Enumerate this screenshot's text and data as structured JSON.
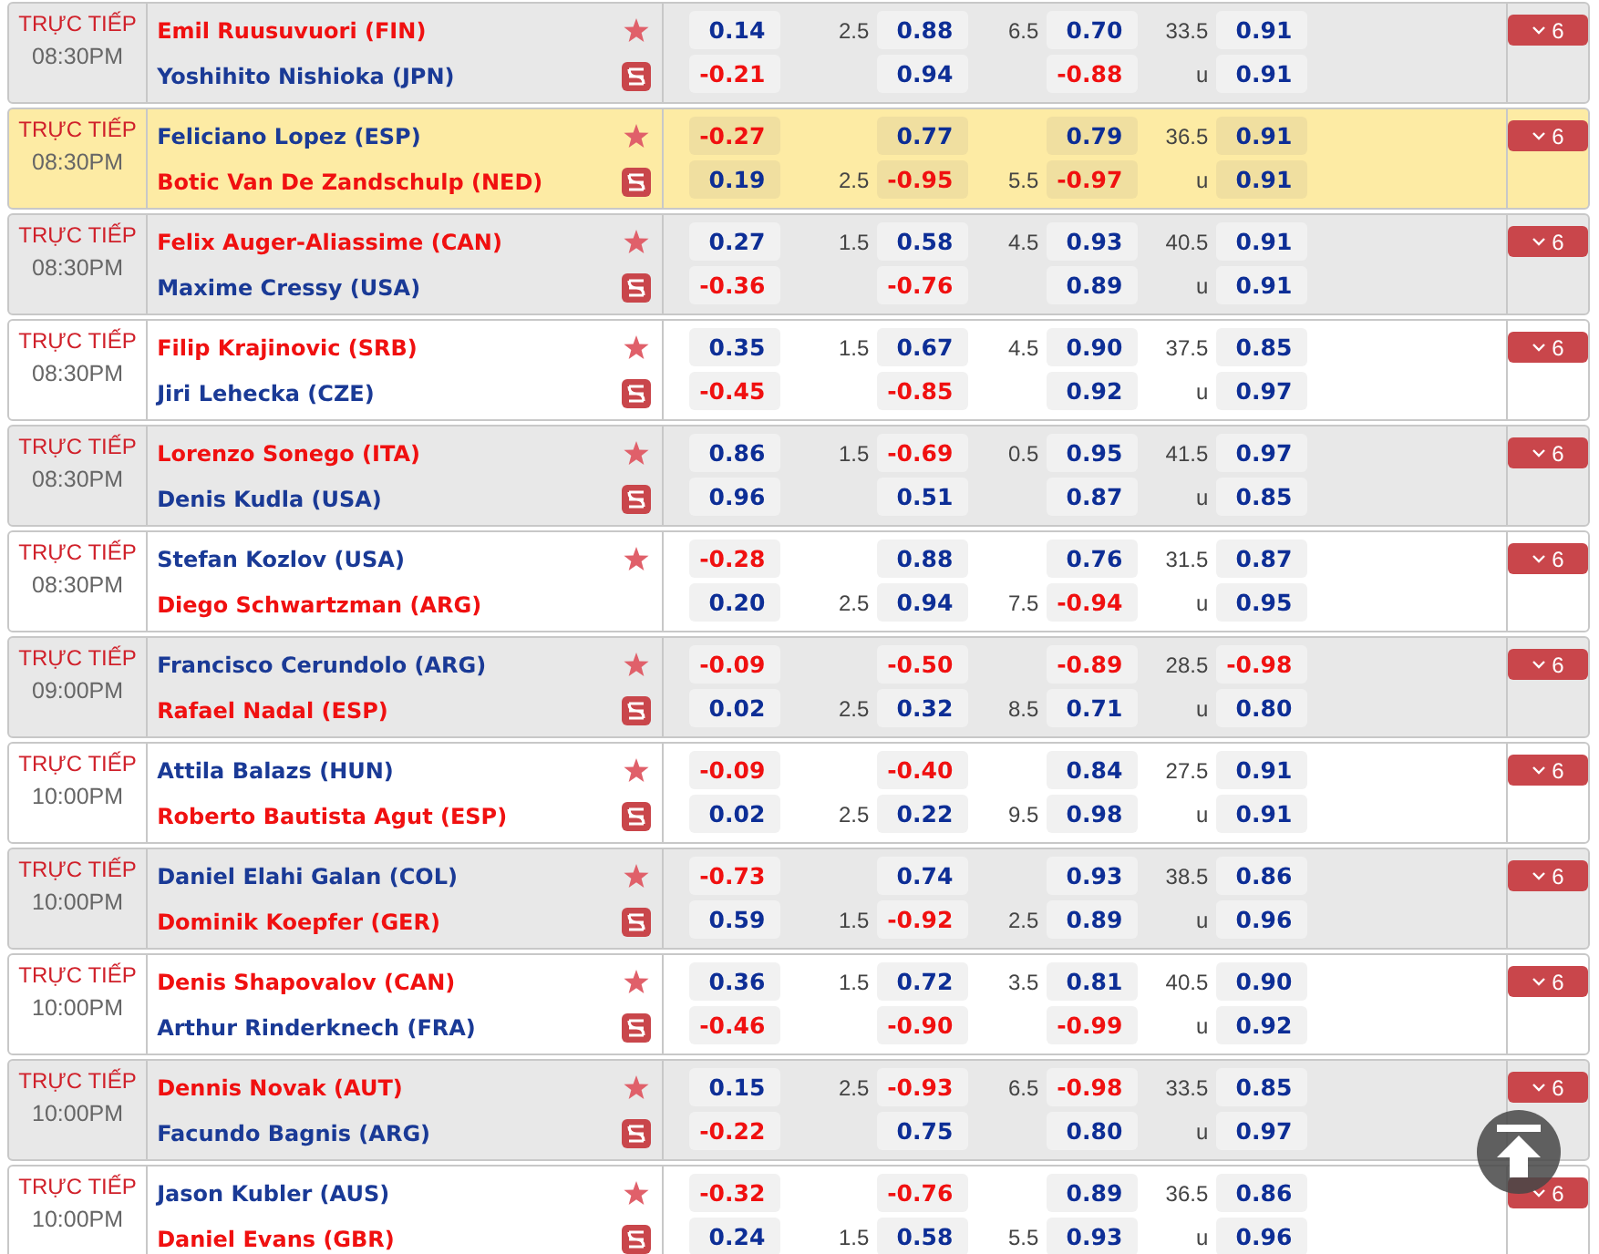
{
  "matches": [
    {
      "status": "TRỰC TIẾP",
      "time": "08:30PM",
      "striped": true,
      "highlighted": false,
      "stream": true,
      "players": [
        {
          "name": "Emil Ruusuvuori (FIN)",
          "favorite": true
        },
        {
          "name": "Yoshihito Nishioka (JPN)",
          "favorite": false
        }
      ],
      "lines": [
        {
          "odds_a": "0.14",
          "line_a": "2.5",
          "odds_b": "0.88",
          "line_b": "6.5",
          "odds_c": "0.70",
          "line_c": "33.5",
          "odds_d": "0.91"
        },
        {
          "odds_a": "-0.21",
          "odds_b": "0.94",
          "odds_c": "-0.88",
          "line_c": "u",
          "odds_d": "0.91"
        }
      ],
      "more": "6"
    },
    {
      "status": "TRỰC TIẾP",
      "time": "08:30PM",
      "striped": false,
      "highlighted": true,
      "stream": true,
      "players": [
        {
          "name": "Feliciano Lopez (ESP)",
          "favorite": false
        },
        {
          "name": "Botic Van De Zandschulp (NED)",
          "favorite": true
        }
      ],
      "lines": [
        {
          "odds_a": "-0.27",
          "odds_b": "0.77",
          "odds_c": "0.79",
          "line_c": "36.5",
          "odds_d": "0.91"
        },
        {
          "odds_a": "0.19",
          "line_a": "2.5",
          "odds_b": "-0.95",
          "line_b": "5.5",
          "odds_c": "-0.97",
          "line_c": "u",
          "odds_d": "0.91"
        }
      ],
      "more": "6"
    },
    {
      "status": "TRỰC TIẾP",
      "time": "08:30PM",
      "striped": true,
      "highlighted": false,
      "stream": true,
      "players": [
        {
          "name": "Felix Auger-Aliassime (CAN)",
          "favorite": true
        },
        {
          "name": "Maxime Cressy (USA)",
          "favorite": false
        }
      ],
      "lines": [
        {
          "odds_a": "0.27",
          "line_a": "1.5",
          "odds_b": "0.58",
          "line_b": "4.5",
          "odds_c": "0.93",
          "line_c": "40.5",
          "odds_d": "0.91"
        },
        {
          "odds_a": "-0.36",
          "odds_b": "-0.76",
          "odds_c": "0.89",
          "line_c": "u",
          "odds_d": "0.91"
        }
      ],
      "more": "6"
    },
    {
      "status": "TRỰC TIẾP",
      "time": "08:30PM",
      "striped": false,
      "highlighted": false,
      "stream": true,
      "players": [
        {
          "name": "Filip Krajinovic (SRB)",
          "favorite": true
        },
        {
          "name": "Jiri Lehecka (CZE)",
          "favorite": false
        }
      ],
      "lines": [
        {
          "odds_a": "0.35",
          "line_a": "1.5",
          "odds_b": "0.67",
          "line_b": "4.5",
          "odds_c": "0.90",
          "line_c": "37.5",
          "odds_d": "0.85"
        },
        {
          "odds_a": "-0.45",
          "odds_b": "-0.85",
          "odds_c": "0.92",
          "line_c": "u",
          "odds_d": "0.97"
        }
      ],
      "more": "6"
    },
    {
      "status": "TRỰC TIẾP",
      "time": "08:30PM",
      "striped": true,
      "highlighted": false,
      "stream": true,
      "players": [
        {
          "name": "Lorenzo Sonego (ITA)",
          "favorite": true
        },
        {
          "name": "Denis Kudla (USA)",
          "favorite": false
        }
      ],
      "lines": [
        {
          "odds_a": "0.86",
          "line_a": "1.5",
          "odds_b": "-0.69",
          "line_b": "0.5",
          "odds_c": "0.95",
          "line_c": "41.5",
          "odds_d": "0.97"
        },
        {
          "odds_a": "0.96",
          "odds_b": "0.51",
          "odds_c": "0.87",
          "line_c": "u",
          "odds_d": "0.85"
        }
      ],
      "more": "6"
    },
    {
      "status": "TRỰC TIẾP",
      "time": "08:30PM",
      "striped": false,
      "highlighted": false,
      "stream": false,
      "players": [
        {
          "name": "Stefan Kozlov (USA)",
          "favorite": false
        },
        {
          "name": "Diego Schwartzman (ARG)",
          "favorite": true
        }
      ],
      "lines": [
        {
          "odds_a": "-0.28",
          "odds_b": "0.88",
          "odds_c": "0.76",
          "line_c": "31.5",
          "odds_d": "0.87"
        },
        {
          "odds_a": "0.20",
          "line_a": "2.5",
          "odds_b": "0.94",
          "line_b": "7.5",
          "odds_c": "-0.94",
          "line_c": "u",
          "odds_d": "0.95"
        }
      ],
      "more": "6"
    },
    {
      "status": "TRỰC TIẾP",
      "time": "09:00PM",
      "striped": true,
      "highlighted": false,
      "stream": true,
      "players": [
        {
          "name": "Francisco Cerundolo (ARG)",
          "favorite": false
        },
        {
          "name": "Rafael Nadal (ESP)",
          "favorite": true
        }
      ],
      "lines": [
        {
          "odds_a": "-0.09",
          "odds_b": "-0.50",
          "odds_c": "-0.89",
          "line_c": "28.5",
          "odds_d": "-0.98"
        },
        {
          "odds_a": "0.02",
          "line_a": "2.5",
          "odds_b": "0.32",
          "line_b": "8.5",
          "odds_c": "0.71",
          "line_c": "u",
          "odds_d": "0.80"
        }
      ],
      "more": "6"
    },
    {
      "status": "TRỰC TIẾP",
      "time": "10:00PM",
      "striped": false,
      "highlighted": false,
      "stream": true,
      "players": [
        {
          "name": "Attila Balazs (HUN)",
          "favorite": false
        },
        {
          "name": "Roberto Bautista Agut (ESP)",
          "favorite": true
        }
      ],
      "lines": [
        {
          "odds_a": "-0.09",
          "odds_b": "-0.40",
          "odds_c": "0.84",
          "line_c": "27.5",
          "odds_d": "0.91"
        },
        {
          "odds_a": "0.02",
          "line_a": "2.5",
          "odds_b": "0.22",
          "line_b": "9.5",
          "odds_c": "0.98",
          "line_c": "u",
          "odds_d": "0.91"
        }
      ],
      "more": "6"
    },
    {
      "status": "TRỰC TIẾP",
      "time": "10:00PM",
      "striped": true,
      "highlighted": false,
      "stream": true,
      "players": [
        {
          "name": "Daniel Elahi Galan (COL)",
          "favorite": false
        },
        {
          "name": "Dominik Koepfer (GER)",
          "favorite": true
        }
      ],
      "lines": [
        {
          "odds_a": "-0.73",
          "odds_b": "0.74",
          "odds_c": "0.93",
          "line_c": "38.5",
          "odds_d": "0.86"
        },
        {
          "odds_a": "0.59",
          "line_a": "1.5",
          "odds_b": "-0.92",
          "line_b": "2.5",
          "odds_c": "0.89",
          "line_c": "u",
          "odds_d": "0.96"
        }
      ],
      "more": "6"
    },
    {
      "status": "TRỰC TIẾP",
      "time": "10:00PM",
      "striped": false,
      "highlighted": false,
      "stream": true,
      "players": [
        {
          "name": "Denis Shapovalov (CAN)",
          "favorite": true
        },
        {
          "name": "Arthur Rinderknech (FRA)",
          "favorite": false
        }
      ],
      "lines": [
        {
          "odds_a": "0.36",
          "line_a": "1.5",
          "odds_b": "0.72",
          "line_b": "3.5",
          "odds_c": "0.81",
          "line_c": "40.5",
          "odds_d": "0.90"
        },
        {
          "odds_a": "-0.46",
          "odds_b": "-0.90",
          "odds_c": "-0.99",
          "line_c": "u",
          "odds_d": "0.92"
        }
      ],
      "more": "6"
    },
    {
      "status": "TRỰC TIẾP",
      "time": "10:00PM",
      "striped": true,
      "highlighted": false,
      "stream": true,
      "players": [
        {
          "name": "Dennis Novak (AUT)",
          "favorite": true
        },
        {
          "name": "Facundo Bagnis (ARG)",
          "favorite": false
        }
      ],
      "lines": [
        {
          "odds_a": "0.15",
          "line_a": "2.5",
          "odds_b": "-0.93",
          "line_b": "6.5",
          "odds_c": "-0.98",
          "line_c": "33.5",
          "odds_d": "0.85"
        },
        {
          "odds_a": "-0.22",
          "odds_b": "0.75",
          "odds_c": "0.80",
          "line_c": "u",
          "odds_d": "0.97"
        }
      ],
      "more": "6"
    },
    {
      "status": "TRỰC TIẾP",
      "time": "10:00PM",
      "striped": false,
      "highlighted": false,
      "stream": true,
      "players": [
        {
          "name": "Jason Kubler (AUS)",
          "favorite": false
        },
        {
          "name": "Daniel Evans (GBR)",
          "favorite": true
        }
      ],
      "lines": [
        {
          "odds_a": "-0.32",
          "odds_b": "-0.76",
          "odds_c": "0.89",
          "line_c": "36.5",
          "odds_d": "0.86"
        },
        {
          "odds_a": "0.24",
          "line_a": "1.5",
          "odds_b": "0.58",
          "line_b": "5.5",
          "odds_c": "0.93",
          "line_c": "u",
          "odds_d": "0.96"
        }
      ],
      "more": "6"
    }
  ]
}
